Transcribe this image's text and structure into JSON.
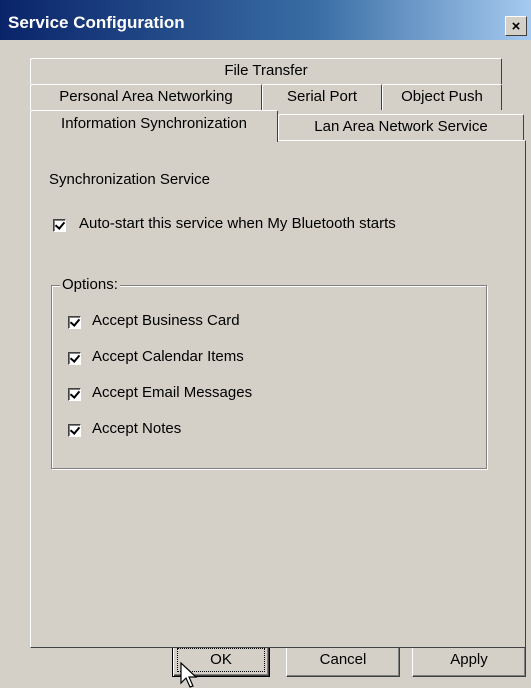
{
  "window": {
    "title": "Service Configuration",
    "close_glyph": "×"
  },
  "tabs": {
    "row1": [
      {
        "label": "File Transfer"
      }
    ],
    "row2": [
      {
        "label": "Personal Area Networking"
      },
      {
        "label": "Serial Port"
      },
      {
        "label": "Object Push"
      }
    ],
    "row3": [
      {
        "label": "Information Synchronization",
        "selected": true
      },
      {
        "label": "Lan Area Network Service"
      }
    ]
  },
  "panel": {
    "heading": "Synchronization Service",
    "autostart": {
      "label": "Auto-start this service when My Bluetooth starts",
      "checked": true
    },
    "options": {
      "title": "Options:",
      "items": [
        {
          "label": "Accept Business Card",
          "checked": true
        },
        {
          "label": "Accept Calendar Items",
          "checked": true
        },
        {
          "label": "Accept Email Messages",
          "checked": true
        },
        {
          "label": "Accept Notes",
          "checked": true
        }
      ]
    }
  },
  "buttons": {
    "ok": "OK",
    "cancel": "Cancel",
    "apply": "Apply"
  },
  "icons": {
    "close": "close-icon",
    "cursor": "mouse-pointer-icon"
  }
}
